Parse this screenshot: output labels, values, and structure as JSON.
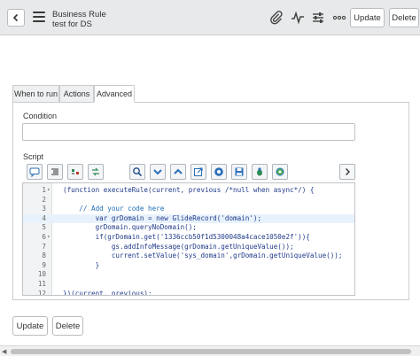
{
  "header": {
    "title": "Business Rule",
    "subtitle": "test for DS",
    "update_label": "Update",
    "delete_label": "Delete",
    "icons": [
      "back-icon",
      "hamburger-menu-icon",
      "paperclip-icon",
      "activity-icon",
      "settings-sliders-icon",
      "more-icon"
    ]
  },
  "tabs": [
    {
      "label": "When to run"
    },
    {
      "label": "Actions"
    },
    {
      "label": "Advanced",
      "active": true
    }
  ],
  "form": {
    "condition_label": "Condition",
    "condition_value": "",
    "script_label": "Script"
  },
  "toolbar": {
    "icons": [
      "comment-icon",
      "format-code-icon",
      "toggle-syntax-icon",
      "replace-icon",
      "search-icon",
      "collapse-icon",
      "expand-icon",
      "open-new-window-icon",
      "help-icon",
      "save-icon",
      "script-debugger-icon",
      "script-tracer-icon"
    ],
    "more_icon": "chevron-right-icon"
  },
  "script": {
    "lines": [
      {
        "n": "1",
        "fold": true,
        "text": "(function executeRule(current, previous /*null when async*/) {"
      },
      {
        "n": "2",
        "text": ""
      },
      {
        "n": "3",
        "text": "    // Add your code here"
      },
      {
        "n": "4",
        "highlight": true,
        "text": "        var grDomain = new GlideRecord('domain');"
      },
      {
        "n": "5",
        "text": "        grDomain.queryNoDomain();"
      },
      {
        "n": "6",
        "fold": true,
        "text": "        if(grDomain.get('1336ccb50f1d5300048a4cace1050e2f')){"
      },
      {
        "n": "7",
        "text": "            gs.addInfoMessage(grDomain.getUniqueValue());"
      },
      {
        "n": "8",
        "text": "            current.setValue('sys_domain',grDomain.getUniqueValue());"
      },
      {
        "n": "9",
        "text": "        }"
      },
      {
        "n": "10",
        "text": ""
      },
      {
        "n": "11",
        "text": ""
      },
      {
        "n": "12",
        "text": "})(current, previous);"
      }
    ]
  },
  "footer": {
    "update_label": "Update",
    "delete_label": "Delete"
  },
  "colors": {
    "header_bg": "#e8e9ea",
    "code_text": "#1f3a8a",
    "comment": "#1c6bb7",
    "string": "#2a6a2a",
    "highlight_line": "#e8f2fc"
  }
}
